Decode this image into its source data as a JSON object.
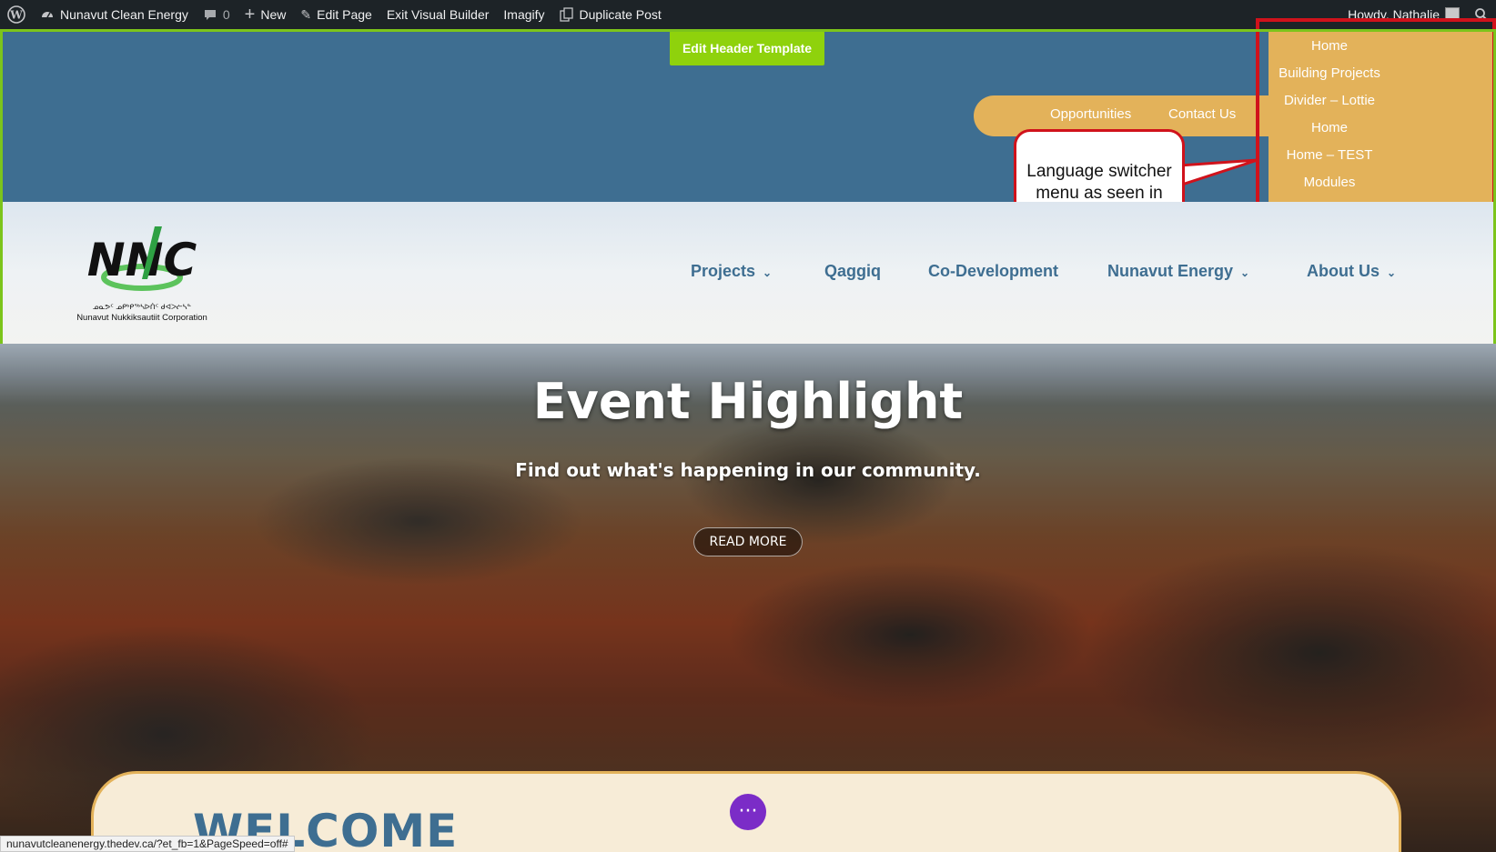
{
  "admin_bar": {
    "site_name": "Nunavut Clean Energy",
    "comments_count": "0",
    "new_label": "New",
    "edit_page_label": "Edit Page",
    "exit_builder_label": "Exit Visual Builder",
    "imagify_label": "Imagify",
    "duplicate_label": "Duplicate Post",
    "howdy_label": "Howdy, Nathalie"
  },
  "header": {
    "edit_template_label": "Edit Header Template",
    "top_links": [
      "Opportunities",
      "Contact Us"
    ],
    "language_menu": [
      "Home",
      "Building Projects",
      "Divider – Lottie",
      "Home",
      "Home – TEST",
      "Modules"
    ]
  },
  "annotation": {
    "callout_text": "Language switcher menu as seen in backend."
  },
  "logo": {
    "letters": "NNC",
    "syllabics": "ᓄᓇᕗᑦ ᓄᑭᒃᑭᖅᓴᐅᑏᑦ ᑯᐊᐳᓖᓴᓐ",
    "name": "Nunavut Nukkiksautiit Corporation"
  },
  "nav": {
    "items": [
      "Projects",
      "Qaggiq",
      "Co-Development",
      "Nunavut Energy",
      "About Us"
    ]
  },
  "hero": {
    "title": "Event Highlight",
    "subtitle": "Find out what's happening in our community.",
    "button": "READ MORE"
  },
  "welcome": {
    "heading": "WELCOME"
  },
  "statusbar": {
    "url": "nunavutcleanenergy.thedev.ca/?et_fb=1&PageSpeed=off#"
  },
  "colors": {
    "header_blue": "#3e6e91",
    "gold": "#e3b25a",
    "admin_bar": "#1d2327",
    "builder_green": "#8fd20c",
    "annotation_red": "#d0121b",
    "fab_purple": "#7b2cc7"
  }
}
